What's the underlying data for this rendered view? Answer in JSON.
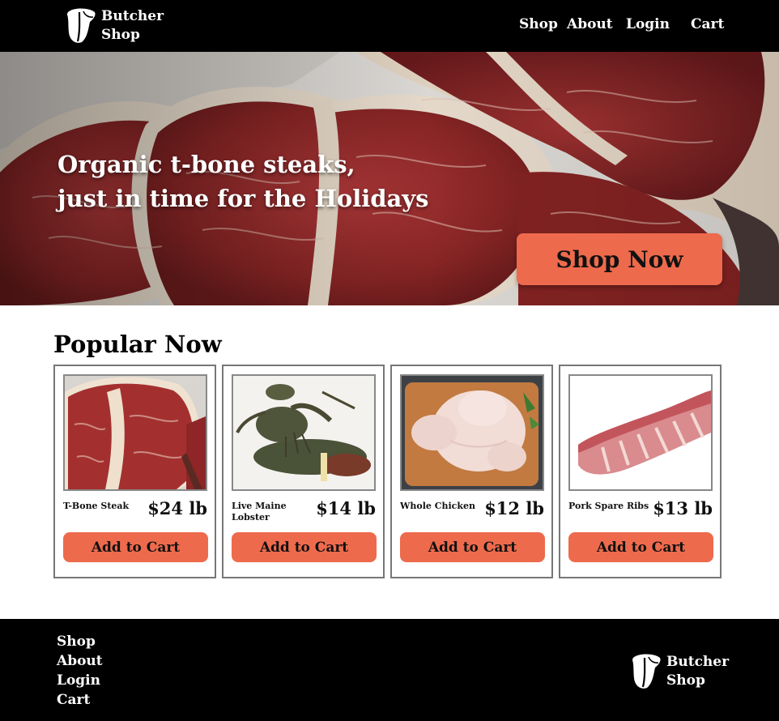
{
  "brand": {
    "name_line1": "Butcher",
    "name_line2": "Shop"
  },
  "nav": {
    "shop": "Shop",
    "about": "About",
    "login": "Login",
    "cart": "Cart"
  },
  "hero": {
    "line1": "Organic t-bone steaks,",
    "line2": "just in time for the Holidays",
    "button": "Shop Now"
  },
  "popular": {
    "title": "Popular Now",
    "products": [
      {
        "name": "T-Bone Steak",
        "price": "$24 lb",
        "button": "Add to Cart"
      },
      {
        "name": "Live Maine Lobster",
        "price": "$14 lb",
        "button": "Add to Cart"
      },
      {
        "name": "Whole Chicken",
        "price": "$12 lb",
        "button": "Add to Cart"
      },
      {
        "name": "Pork Spare Ribs",
        "price": "$13 lb",
        "button": "Add to Cart"
      }
    ]
  },
  "footer": {
    "links": [
      "Shop",
      "About",
      "Login",
      "Cart"
    ],
    "brand_line1": "Butcher",
    "brand_line2": "Shop"
  },
  "colors": {
    "accent": "#ee6a4c",
    "header_bg": "#000000",
    "card_border": "#777777"
  },
  "icons": {
    "logo": "t-bone-icon"
  }
}
